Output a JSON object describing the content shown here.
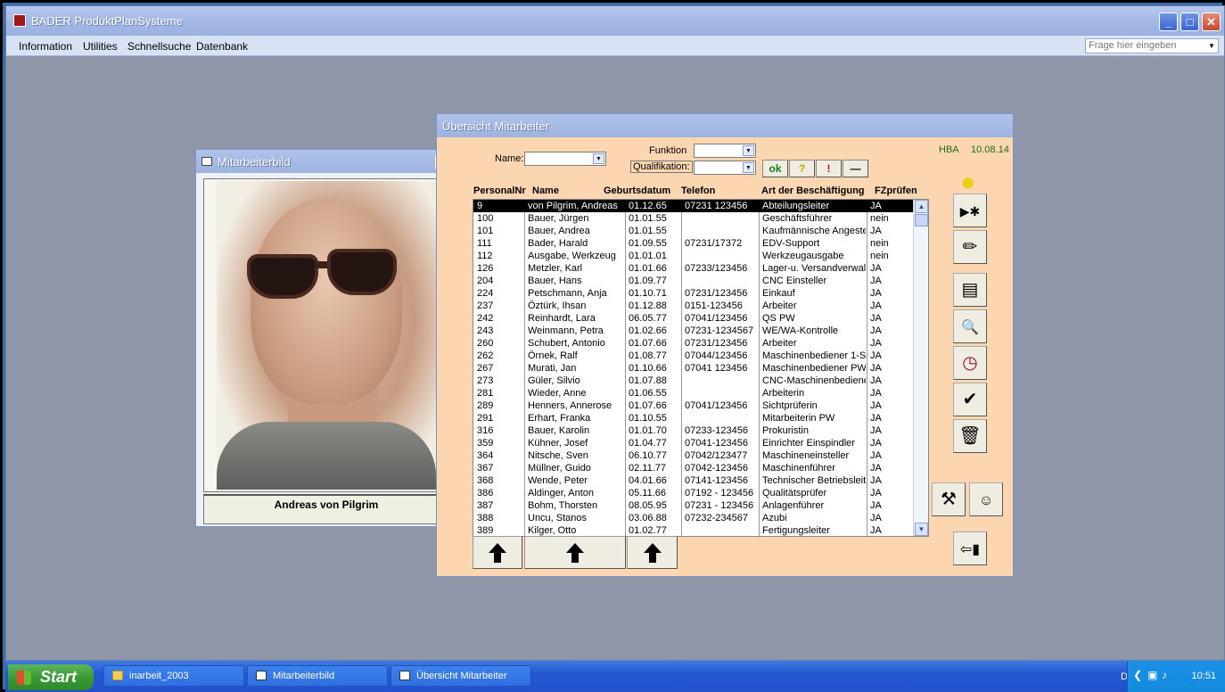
{
  "app": {
    "title": "BADER ProduktPlanSysteme"
  },
  "menu": [
    "Information",
    "Utilities",
    "Schnellsuche",
    "Datenbank"
  ],
  "help_placeholder": "Frage hier eingeben",
  "bild_window": {
    "title": "Mitarbeiterbild",
    "employee_name": "Andreas von Pilgrim"
  },
  "ueb_window": {
    "title": "Übersicht Mitarbeiter",
    "name_label": "Name:",
    "funktion_label": "Funktion",
    "qualifikation_label": "Qualifikation:",
    "buttons": {
      "ok": "ok",
      "question": "?",
      "exclaim": "!",
      "minus": "—"
    },
    "user": "HBA",
    "date": "10.08.14",
    "columns": [
      "PersonalNr",
      "Name",
      "Geburtsdatum",
      "Telefon",
      "Art der Beschäftigung",
      "FZprüfen"
    ],
    "rows": [
      [
        "9",
        "von Pilgrim, Andreas",
        "01.12.65",
        "07231 123456",
        "Abteilungsleiter",
        "JA"
      ],
      [
        "100",
        "Bauer, Jürgen",
        "01.01.55",
        "",
        "Geschäftsführer",
        "nein"
      ],
      [
        "101",
        "Bauer, Andrea",
        "01.01.55",
        "",
        "Kaufmännische Angeste",
        "JA"
      ],
      [
        "111",
        "Bader, Harald",
        "01.09.55",
        "07231/17372",
        "EDV-Support",
        "nein"
      ],
      [
        "112",
        "Ausgabe, Werkzeug",
        "01.01.01",
        "",
        "Werkzeugausgabe",
        "nein"
      ],
      [
        "126",
        "Metzler, Karl",
        "01.01.66",
        "07233/123456",
        "Lager-u. Versandverwalt",
        "JA"
      ],
      [
        "204",
        "Bauer, Hans",
        "01.09.77",
        "",
        "CNC Einsteller",
        "JA"
      ],
      [
        "224",
        "Petschmann, Anja",
        "01.10.71",
        "07231/123456",
        "Einkauf",
        "JA"
      ],
      [
        "237",
        "Öztürk, Ihsan",
        "01.12.88",
        "0151-123456",
        "Arbeiter",
        "JA"
      ],
      [
        "242",
        "Reinhardt, Lara",
        "06.05.77",
        "07041/123456",
        "QS PW",
        "JA"
      ],
      [
        "243",
        "Weinmann, Petra",
        "01.02.66",
        "07231-1234567",
        "WE/WA-Kontrolle",
        "JA"
      ],
      [
        "260",
        "Schubert, Antonio",
        "01.07.66",
        "07231/123456",
        "Arbeiter",
        "JA"
      ],
      [
        "262",
        "Örnek, Ralf",
        "01.08.77",
        "07044/123456",
        "Maschinenbediener 1-Sp",
        "JA"
      ],
      [
        "267",
        "Murati, Jan",
        "01.10.66",
        "07041 123456",
        "Maschinenbediener PW",
        "JA"
      ],
      [
        "273",
        "Güler, Silvio",
        "01.07.88",
        "",
        "CNC-Maschinenbediene",
        "JA"
      ],
      [
        "281",
        "Wieder, Anne",
        "01.06.55",
        "",
        "Arbeiterin",
        "JA"
      ],
      [
        "289",
        "Henners, Annerose",
        "01.07.66",
        "07041/123456",
        "Sichtprüferin",
        "JA"
      ],
      [
        "291",
        "Erhart, Franka",
        "01.10.55",
        "",
        "Mitarbeiterin PW",
        "JA"
      ],
      [
        "316",
        "Bauer, Karolin",
        "01.01.70",
        "07233-123456",
        "Prokuristin",
        "JA"
      ],
      [
        "359",
        "Kühner, Josef",
        "01.04.77",
        "07041-123456",
        "Einrichter Einspindler",
        "JA"
      ],
      [
        "364",
        "Nitsche, Sven",
        "06.10.77",
        "07042/123477",
        "Maschineneinsteller",
        "JA"
      ],
      [
        "367",
        "Müllner, Guido",
        "02.11.77",
        "07042-123456",
        "Maschinenführer",
        "JA"
      ],
      [
        "368",
        "Wende, Peter",
        "04.01.66",
        "07141-123456",
        "Technischer Betriebsleite",
        "JA"
      ],
      [
        "386",
        "Aldinger, Anton",
        "05.11.66",
        "07192 - 123456",
        "Qualitätsprüfer",
        "JA"
      ],
      [
        "387",
        "Bohm, Thorsten",
        "08.05.95",
        "07231 - 123456",
        "Anlagenführer",
        "JA"
      ],
      [
        "388",
        "Uncu, Stanos",
        "03.06.88",
        "07232-234567",
        "Azubi",
        "JA"
      ],
      [
        "389",
        "Kilger, Otto",
        "01.02.77",
        "",
        "Fertigungsleiter",
        "JA"
      ]
    ]
  },
  "taskbar": {
    "start": "Start",
    "tasks": [
      "inarbeit_2003",
      "Mitarbeiterbild",
      "Übersicht Mitarbeiter"
    ],
    "lang": "DE",
    "clock": "10:51"
  }
}
